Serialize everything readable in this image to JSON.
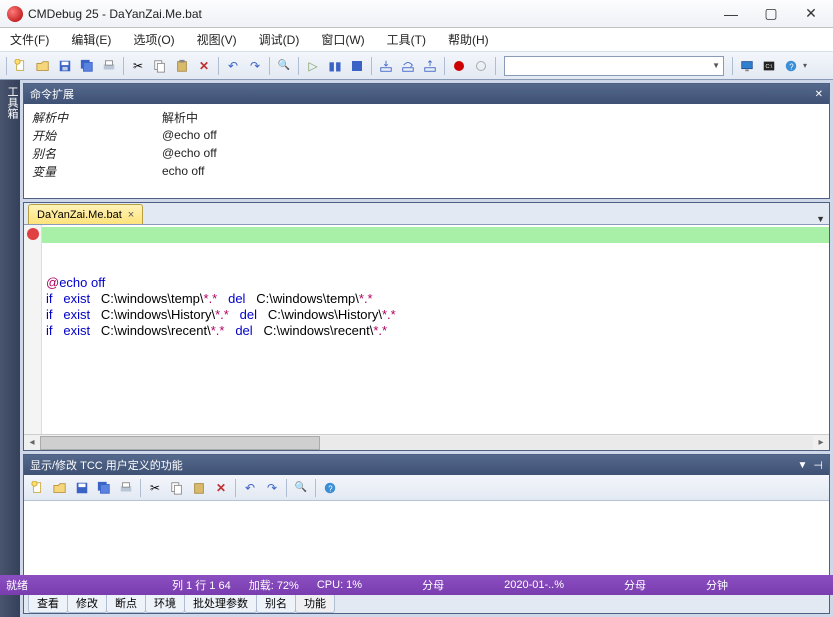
{
  "title": "CMDebug 25 - DaYanZai.Me.bat",
  "menu": {
    "file": "文件(F)",
    "edit": "编辑(E)",
    "options": "选项(O)",
    "view": "视图(V)",
    "debug": "调试(D)",
    "window": "窗口(W)",
    "tools": "工具(T)",
    "help": "帮助(H)"
  },
  "sidebar_label": "工具箱",
  "cmd_panel": {
    "title": "命令扩展",
    "rows": [
      {
        "k": "解析中",
        "v": "解析中"
      },
      {
        "k": "开始",
        "v": "@echo off"
      },
      {
        "k": "别名",
        "v": "@echo off"
      },
      {
        "k": "变量",
        "v": "echo off"
      }
    ]
  },
  "editor": {
    "tab": "DaYanZai.Me.bat",
    "lines": [
      {
        "t": "@echo off",
        "hl": true,
        "kw": []
      },
      {
        "parts": [
          {
            "c": "kw",
            "t": "if"
          },
          {
            "t": "   "
          },
          {
            "c": "kw",
            "t": "exist"
          },
          {
            "t": "   C:\\windows\\temp\\"
          },
          {
            "c": "str",
            "t": "*.*"
          },
          {
            "t": "   "
          },
          {
            "c": "kw",
            "t": "del"
          },
          {
            "t": "   C:\\windows\\temp\\"
          },
          {
            "c": "str",
            "t": "*.*"
          }
        ]
      },
      {
        "parts": [
          {
            "c": "kw",
            "t": "if"
          },
          {
            "t": "   "
          },
          {
            "c": "kw",
            "t": "exist"
          },
          {
            "t": "   C:\\windows\\History\\"
          },
          {
            "c": "str",
            "t": "*.*"
          },
          {
            "t": "   "
          },
          {
            "c": "kw",
            "t": "del"
          },
          {
            "t": "   C:\\windows\\History\\"
          },
          {
            "c": "str",
            "t": "*.*"
          }
        ]
      },
      {
        "parts": [
          {
            "c": "kw",
            "t": "if"
          },
          {
            "t": "   "
          },
          {
            "c": "kw",
            "t": "exist"
          },
          {
            "t": "   C:\\windows\\recent\\"
          },
          {
            "c": "str",
            "t": "*.*"
          },
          {
            "t": "   "
          },
          {
            "c": "kw",
            "t": "del"
          },
          {
            "t": "   C:\\windows\\recent\\"
          },
          {
            "c": "str",
            "t": "*.*"
          }
        ]
      }
    ]
  },
  "bottom_panel": {
    "title": "显示/修改 TCC 用户定义的功能"
  },
  "bottom_tabs": [
    "查看",
    "修改",
    "断点",
    "环境",
    "批处理参数",
    "别名",
    "功能"
  ],
  "bottom_active": 6,
  "status": {
    "ready": "就绪",
    "pos": "列 1 行 1  64",
    "load": "加载: 72%",
    "cpu": "CPU:  1%",
    "s1": "分母",
    "date": "2020-01-..%",
    "s2": "分母",
    "s3": "分钟"
  }
}
